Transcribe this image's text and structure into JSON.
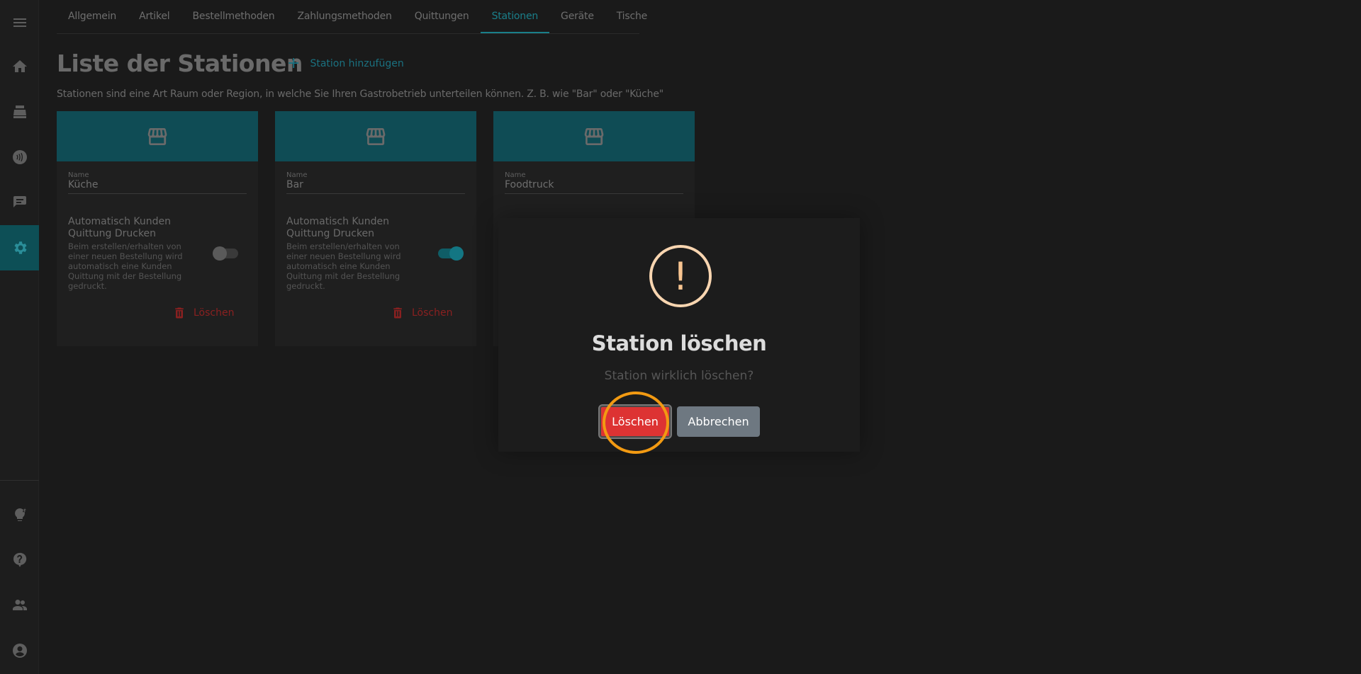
{
  "tabs": [
    {
      "label": "Allgemein"
    },
    {
      "label": "Artikel"
    },
    {
      "label": "Bestellmethoden"
    },
    {
      "label": "Zahlungsmethoden"
    },
    {
      "label": "Quittungen"
    },
    {
      "label": "Stationen",
      "active": true
    },
    {
      "label": "Geräte"
    },
    {
      "label": "Tische"
    }
  ],
  "page": {
    "title": "Liste der Stationen",
    "add_label": "Station hinzufügen",
    "subtitle": "Stationen sind eine Art Raum oder Region, in welche Sie Ihren Gastrobetrieb unterteilen können. Z. B. wie \"Bar\" oder \"Küche\""
  },
  "cards": [
    {
      "name_label": "Name",
      "name": "Küche",
      "auto_title": "Automatisch Kunden Quittung Drucken",
      "auto_desc": "Beim erstellen/erhalten von einer neuen Bestellung wird automatisch eine Kunden Quittung mit der Bestellung gedruckt.",
      "auto_print": false,
      "delete_label": "Löschen"
    },
    {
      "name_label": "Name",
      "name": "Bar",
      "auto_title": "Automatisch Kunden Quittung Drucken",
      "auto_desc": "Beim erstellen/erhalten von einer neuen Bestellung wird automatisch eine Kunden Quittung mit der Bestellung gedruckt.",
      "auto_print": true,
      "delete_label": "Löschen"
    },
    {
      "name_label": "Name",
      "name": "Foodtruck"
    }
  ],
  "dialog": {
    "icon": "!",
    "title": "Station löschen",
    "text": "Station wirklich löschen?",
    "confirm_label": "Löschen",
    "cancel_label": "Abbrechen"
  },
  "sidebar_icons": [
    "menu-icon",
    "home-icon",
    "cash-register-icon",
    "contactless-icon",
    "order-list-icon",
    "settings-icon",
    "lightbulb-icon",
    "help-icon",
    "users-icon",
    "account-icon"
  ],
  "colors": {
    "accent": "#1a7f8a",
    "danger": "#dd3333",
    "warning": "#f8c490",
    "highlight": "#f29a12"
  }
}
